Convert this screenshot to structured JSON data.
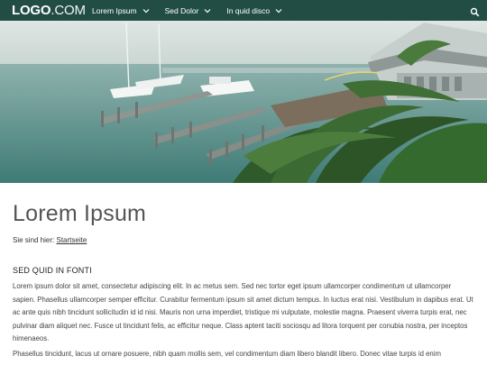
{
  "nav": {
    "logo_strong": "LOGO",
    "logo_light": ".COM",
    "items": [
      {
        "label": "Lorem Ipsum"
      },
      {
        "label": "Sed Dolor"
      },
      {
        "label": "In quid disco"
      }
    ],
    "icons": {
      "chevron": "chevron-down-icon",
      "search": "search-icon"
    },
    "background": "#224d45"
  },
  "hero": {
    "image": "photo of marina with docks, boats, misty water and palm trees"
  },
  "main": {
    "title": "Lorem Ipsum",
    "breadcrumb_prefix": "Sie sind hier:",
    "breadcrumb_link": "Startseite",
    "section_title": "SED QUID IN FONTI",
    "paragraph1": "Lorem ipsum dolor sit amet, consectetur adipiscing elit. In ac metus sem. Sed nec tortor eget ipsum ullamcorper condimentum ut ullamcorper sapien. Phasellus ullamcorper semper efficitur. Curabitur fermentum ipsum sit amet dictum tempus. In luctus erat nisi. Vestibulum in dapibus erat. Ut ac ante quis nibh tincidunt sollicitudin id id nisi. Mauris non urna imperdiet, tristique mi vulputate, molestie magna. Praesent viverra turpis erat, nec pulvinar diam aliquet nec. Fusce ut tincidunt felis, ac efficitur neque. Class aptent taciti sociosqu ad litora torquent per conubia nostra, per inceptos himenaeos.",
    "paragraph2": "Phasellus tincidunt, lacus ut ornare posuere, nibh quam mollis sem, vel condimentum diam libero blandit libero. Donec vitae turpis id enim"
  }
}
